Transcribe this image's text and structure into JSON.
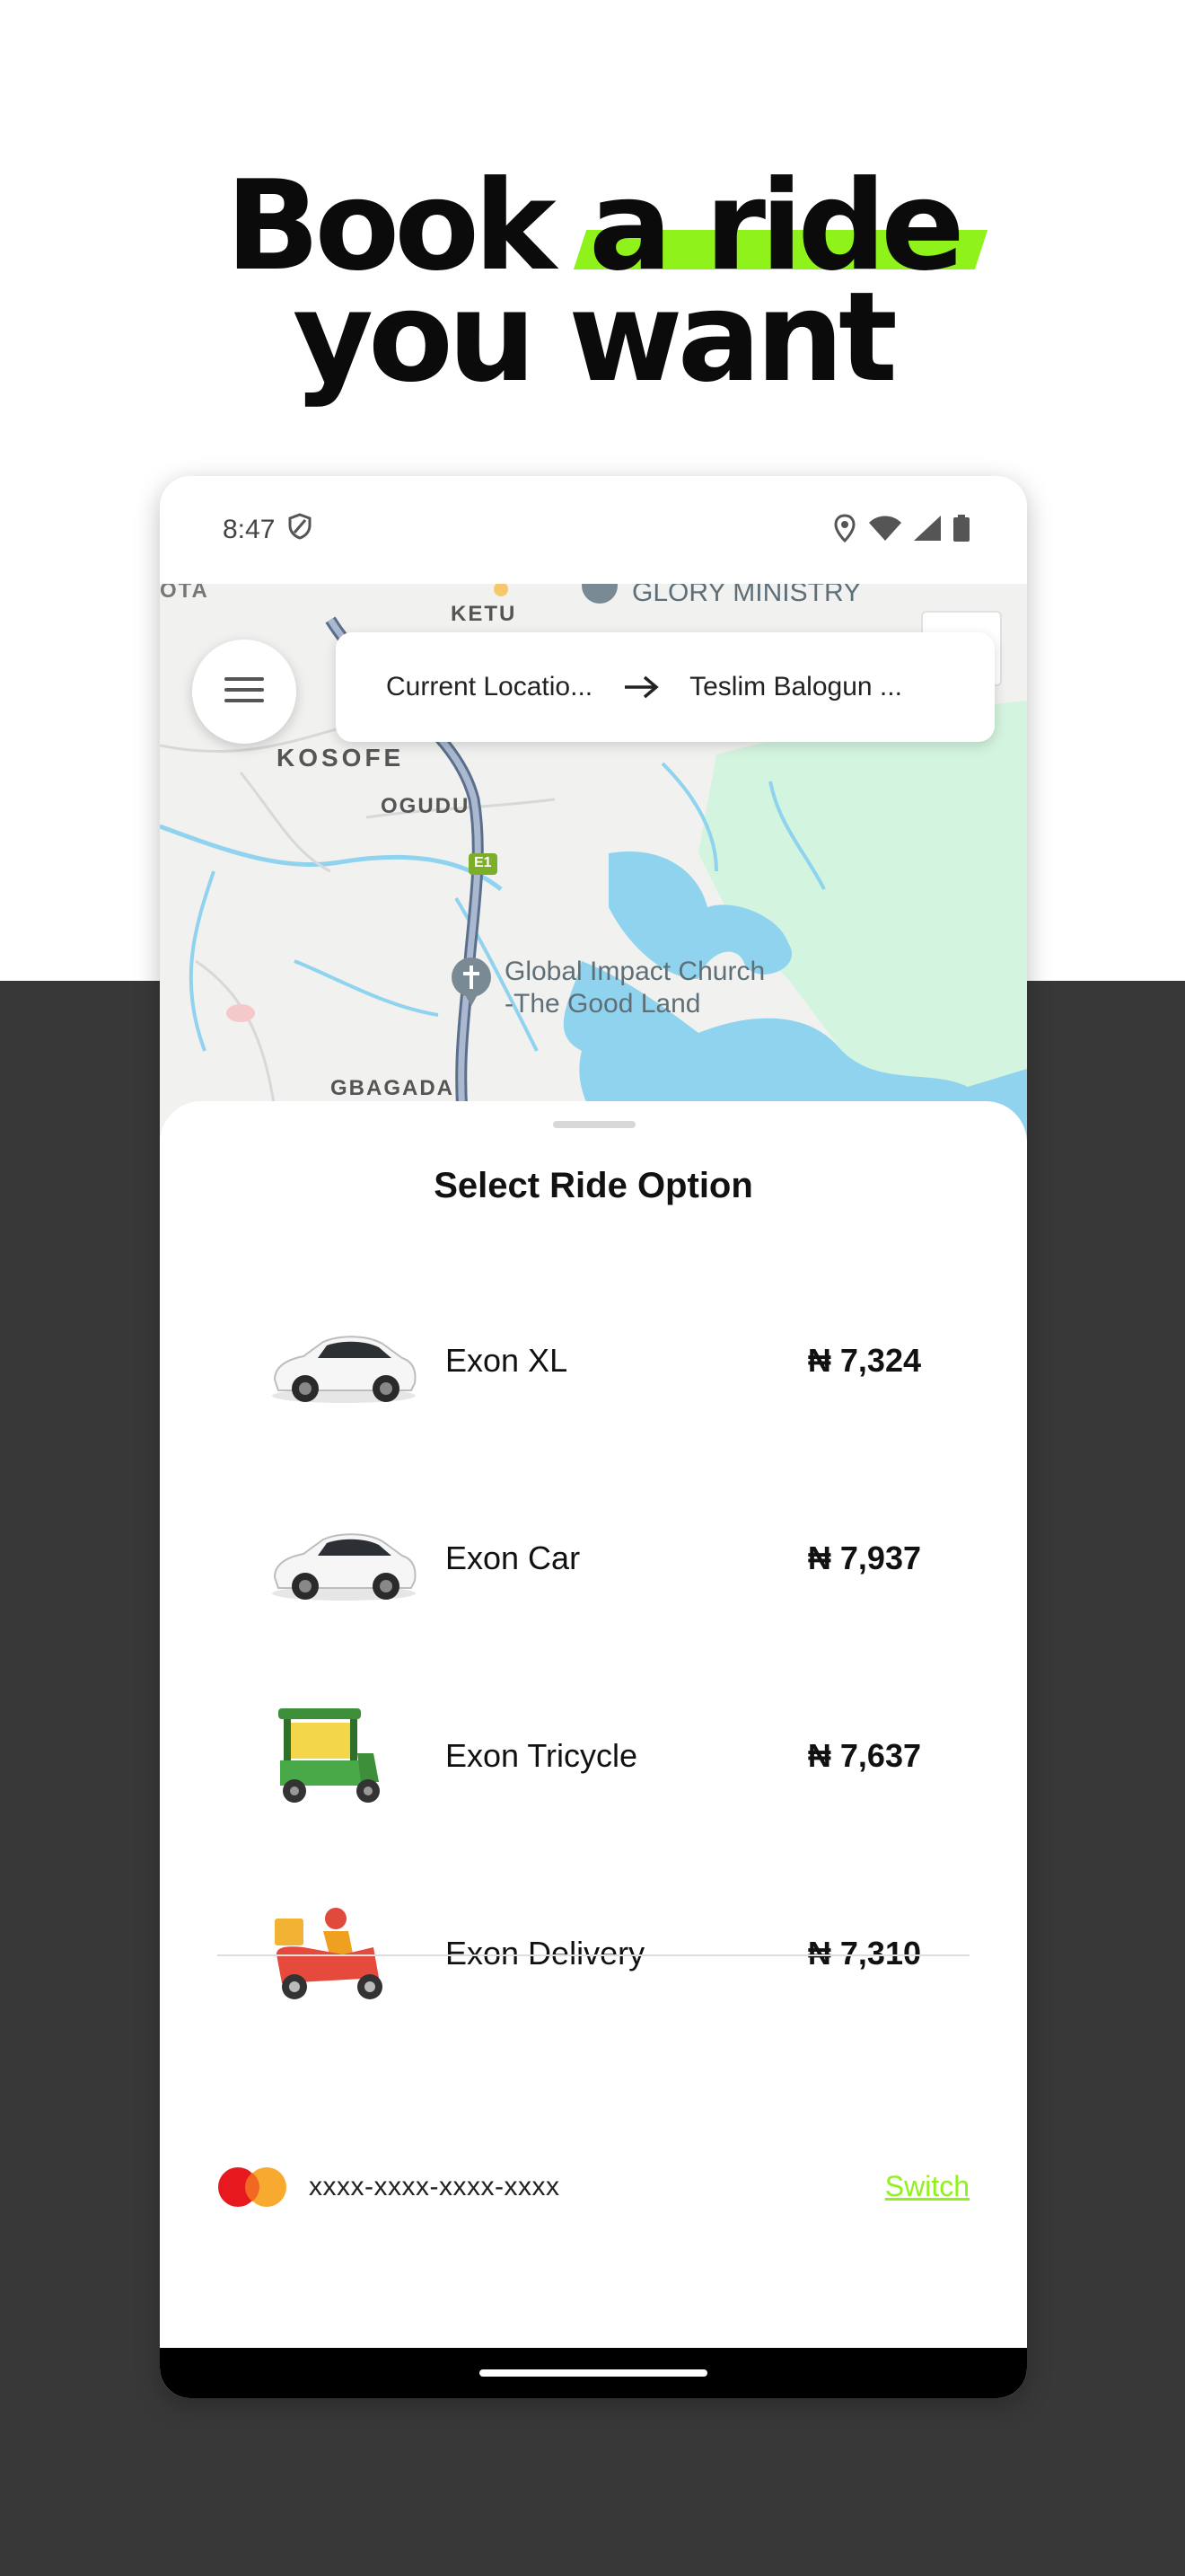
{
  "promo": {
    "headline_line1_a": "Book",
    "headline_line1_b": "a ride",
    "headline_line2": "you want",
    "highlight_color": "#8ff21a",
    "bottom_background": "#383838"
  },
  "status_bar": {
    "time": "8:47",
    "icons": [
      "shield-icon",
      "location-icon",
      "wifi-icon",
      "signal-icon",
      "battery-icon"
    ]
  },
  "map": {
    "labels": {
      "ketu": "KETU",
      "kosofe": "KOSOFE",
      "ogudu": "OGUDU",
      "gbagada": "GBAGADA",
      "ota": "OTA",
      "e1": "E1"
    },
    "pois": {
      "glory": "GLORY MINISTRY",
      "church_line1": "Global Impact Church",
      "church_line2": "-The Good Land"
    }
  },
  "route": {
    "from": "Current Locatio...",
    "to": "Teslim Balogun ..."
  },
  "sheet": {
    "title": "Select Ride Option"
  },
  "rides": [
    {
      "name": "Exon XL",
      "price": "₦ 7,324",
      "vehicle_icon": "car-icon"
    },
    {
      "name": "Exon Car",
      "price": "₦ 7,937",
      "vehicle_icon": "car-icon"
    },
    {
      "name": "Exon Tricycle",
      "price": "₦ 7,637",
      "vehicle_icon": "tricycle-icon"
    },
    {
      "name": "Exon Delivery",
      "price": "₦ 7,310",
      "vehicle_icon": "delivery-scooter-icon"
    }
  ],
  "payment": {
    "card_brand_icon": "mastercard-icon",
    "card_number": "xxxx-xxxx-xxxx-xxxx",
    "switch_label": "Switch",
    "switch_color": "#8ff21a"
  }
}
